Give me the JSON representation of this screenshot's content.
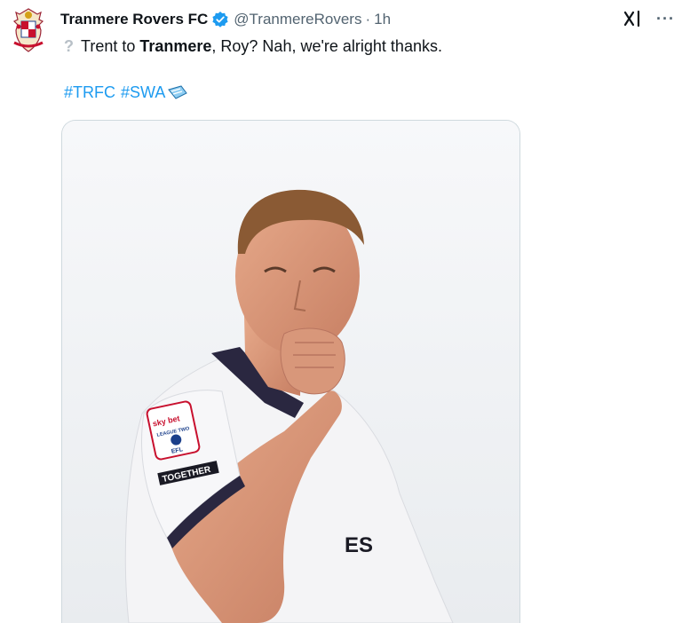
{
  "account": {
    "display_name": "Tranmere Rovers FC",
    "handle": "@TranmereRovers",
    "separator": "·",
    "time": "1h"
  },
  "icons": {
    "avatar": "club-crest-icon",
    "verified": "verified-badge-icon",
    "grok": "grok-icon",
    "more": "more-options-icon",
    "hashtag_emoji": "hashtag-emoji-icon"
  },
  "tweet": {
    "question_emoji": "?",
    "text_part1": "Trent to ",
    "text_bold": "Tranmere",
    "text_part2": ", Roy? Nah, we're alright thanks.",
    "hashtags": [
      "#TRFC",
      "#SWA"
    ]
  },
  "more_glyph": "···",
  "image": {
    "sleeve_badge_top": "sky bet",
    "sleeve_badge_league": "LEAGUE TWO",
    "sleeve_badge_efl": "EFL",
    "sleeve_text": "TOGETHER",
    "shirt_text": "ES"
  },
  "colors": {
    "link": "#1d9bf0",
    "verified": "#1d9bf0",
    "secondary_text": "#536471"
  }
}
